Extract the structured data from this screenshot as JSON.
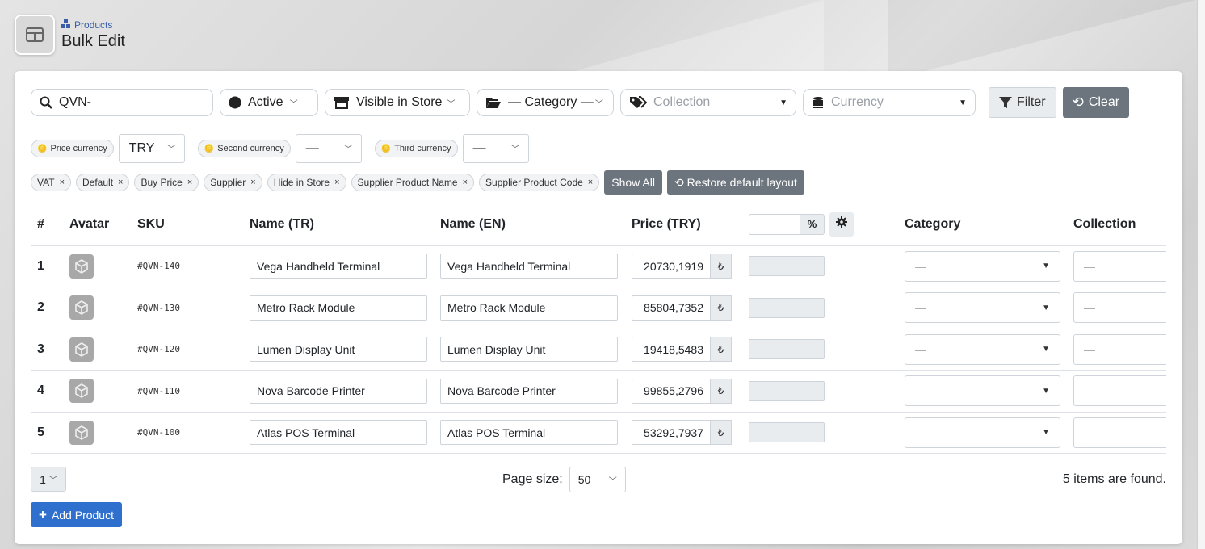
{
  "header": {
    "breadcrumb": "Products",
    "title": "Bulk Edit"
  },
  "filters": {
    "search_value": "QVN-",
    "status": "Active",
    "visibility": "Visible in Store",
    "category": "— Category —",
    "collection_placeholder": "Collection",
    "currency_placeholder": "Currency",
    "filter_label": "Filter",
    "clear_label": "Clear"
  },
  "currencies": {
    "price_label": "Price currency",
    "price_value": "TRY",
    "second_label": "Second currency",
    "second_value": "—",
    "third_label": "Third currency",
    "third_value": "—"
  },
  "hidden_columns": [
    "VAT",
    "Default",
    "Buy Price",
    "Supplier",
    "Hide in Store",
    "Supplier Product Name",
    "Supplier Product Code"
  ],
  "buttons": {
    "show_all": "Show All",
    "restore_layout": "Restore default layout",
    "add_product": "Add Product"
  },
  "table": {
    "headers": {
      "num": "#",
      "avatar": "Avatar",
      "sku": "SKU",
      "name_tr": "Name (TR)",
      "name_en": "Name (EN)",
      "price": "Price (TRY)",
      "pct": "%",
      "category": "Category",
      "collection": "Collection"
    },
    "currency_symbol": "₺",
    "placeholder": "—",
    "rows": [
      {
        "num": "1",
        "sku": "#QVN-140",
        "name_tr": "Vega Handheld Terminal",
        "name_en": "Vega Handheld Terminal",
        "price": "20730,1919"
      },
      {
        "num": "2",
        "sku": "#QVN-130",
        "name_tr": "Metro Rack Module",
        "name_en": "Metro Rack Module",
        "price": "85804,7352"
      },
      {
        "num": "3",
        "sku": "#QVN-120",
        "name_tr": "Lumen Display Unit",
        "name_en": "Lumen Display Unit",
        "price": "19418,5483"
      },
      {
        "num": "4",
        "sku": "#QVN-110",
        "name_tr": "Nova Barcode Printer",
        "name_en": "Nova Barcode Printer",
        "price": "99855,2796"
      },
      {
        "num": "5",
        "sku": "#QVN-100",
        "name_tr": "Atlas POS Terminal",
        "name_en": "Atlas POS Terminal",
        "price": "53292,7937"
      }
    ]
  },
  "footer": {
    "page": "1",
    "page_size_label": "Page size:",
    "page_size": "50",
    "found_text": "5 items are found."
  }
}
